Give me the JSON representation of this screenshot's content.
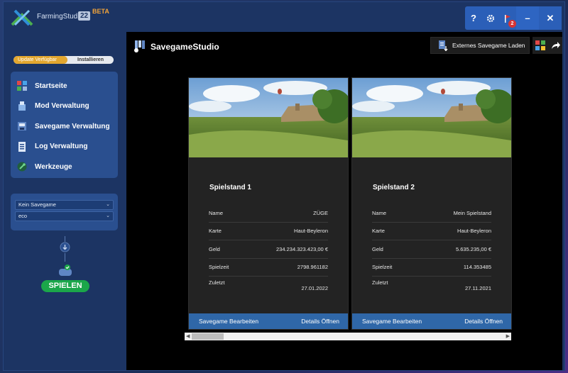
{
  "app": {
    "name": "FarmingStudio",
    "version": "22",
    "beta": "BETA"
  },
  "window_controls": {
    "notification_count": "2"
  },
  "update": {
    "label": "Update Verfügbar",
    "install_label": "Installieren"
  },
  "nav": {
    "items": [
      {
        "label": "Startseite",
        "icon": "home-grid-icon"
      },
      {
        "label": "Mod Verwaltung",
        "icon": "mod-box-icon"
      },
      {
        "label": "Savegame Verwaltung",
        "icon": "savegame-icon"
      },
      {
        "label": "Log Verwaltung",
        "icon": "log-icon"
      },
      {
        "label": "Werkzeuge",
        "icon": "tools-icon"
      }
    ]
  },
  "savegame_select": {
    "selected": "Kein Savegame",
    "profile": "eco"
  },
  "play": {
    "label": "SPIELEN"
  },
  "main": {
    "title": "SavegameStudio",
    "external_button": "Externes Savegame Laden"
  },
  "cards": [
    {
      "title": "Spielstand 1",
      "rows": [
        {
          "label": "Name",
          "value": "ZÜGE"
        },
        {
          "label": "Karte",
          "value": "Haut-Beyleron"
        },
        {
          "label": "Geld",
          "value": "234.234.323.423,00 €"
        },
        {
          "label": "Spielzeit",
          "value": "2798.961182"
        },
        {
          "label": "Zuletzt",
          "value": "27.01.2022"
        }
      ],
      "edit_label": "Savegame Bearbeiten",
      "details_label": "Details Öffnen"
    },
    {
      "title": "Spielstand 2",
      "rows": [
        {
          "label": "Name",
          "value": "Mein Spielstand"
        },
        {
          "label": "Karte",
          "value": "Haut-Beyleron"
        },
        {
          "label": "Geld",
          "value": "5.635.235,00 €"
        },
        {
          "label": "Spielzeit",
          "value": "114.353485"
        },
        {
          "label": "Zuletzt",
          "value": "27.11.2021"
        }
      ],
      "edit_label": "Savegame Bearbeiten",
      "details_label": "Details Öffnen"
    }
  ],
  "colors": {
    "sidebar_bg": "#1c3463",
    "panel_bg": "#2a4f8f",
    "accent_blue": "#2f67a8",
    "play_green": "#1ba64a",
    "update_orange": "#e3a72f"
  }
}
